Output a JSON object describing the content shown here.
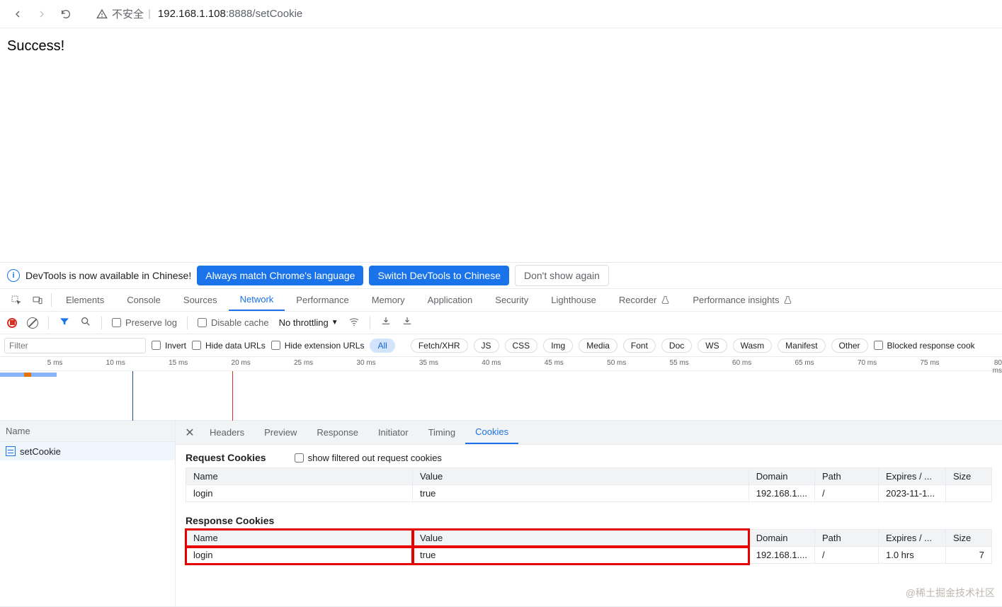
{
  "browser": {
    "insecure_label": "不安全",
    "url_host": "192.168.1.108",
    "url_port": ":8888",
    "url_path": "/setCookie"
  },
  "page": {
    "body_text": "Success!"
  },
  "infobar": {
    "message": "DevTools is now available in Chinese!",
    "btn_match": "Always match Chrome's language",
    "btn_switch": "Switch DevTools to Chinese",
    "btn_dismiss": "Don't show again"
  },
  "panels": {
    "elements": "Elements",
    "console": "Console",
    "sources": "Sources",
    "network": "Network",
    "performance": "Performance",
    "memory": "Memory",
    "application": "Application",
    "security": "Security",
    "lighthouse": "Lighthouse",
    "recorder": "Recorder",
    "perf_insights": "Performance insights"
  },
  "toolbar": {
    "preserve_log": "Preserve log",
    "disable_cache": "Disable cache",
    "no_throttling": "No throttling"
  },
  "filter": {
    "placeholder": "Filter",
    "invert": "Invert",
    "hide_data": "Hide data URLs",
    "hide_ext": "Hide extension URLs",
    "chips": [
      "All",
      "Fetch/XHR",
      "JS",
      "CSS",
      "Img",
      "Media",
      "Font",
      "Doc",
      "WS",
      "Wasm",
      "Manifest",
      "Other"
    ],
    "blocked": "Blocked response cook"
  },
  "timeline": {
    "ticks": [
      "5 ms",
      "10 ms",
      "15 ms",
      "20 ms",
      "25 ms",
      "30 ms",
      "35 ms",
      "40 ms",
      "45 ms",
      "50 ms",
      "55 ms",
      "60 ms",
      "65 ms",
      "70 ms",
      "75 ms",
      "80 ms"
    ]
  },
  "reqlist": {
    "header": "Name",
    "items": [
      "setCookie"
    ]
  },
  "detail": {
    "tabs": {
      "headers": "Headers",
      "preview": "Preview",
      "response": "Response",
      "initiator": "Initiator",
      "timing": "Timing",
      "cookies": "Cookies"
    },
    "request_cookies_title": "Request Cookies",
    "show_filtered_label": "show filtered out request cookies",
    "response_cookies_title": "Response Cookies",
    "columns": {
      "name": "Name",
      "value": "Value",
      "domain": "Domain",
      "path": "Path",
      "expires": "Expires / ...",
      "size": "Size"
    },
    "request_rows": [
      {
        "name": "login",
        "value": "true",
        "domain": "192.168.1....",
        "path": "/",
        "expires": "2023-11-1...",
        "size": ""
      }
    ],
    "response_rows": [
      {
        "name": "login",
        "value": "true",
        "domain": "192.168.1....",
        "path": "/",
        "expires": "1.0 hrs",
        "size": "7"
      }
    ]
  },
  "watermark": "@稀土掘金技术社区"
}
